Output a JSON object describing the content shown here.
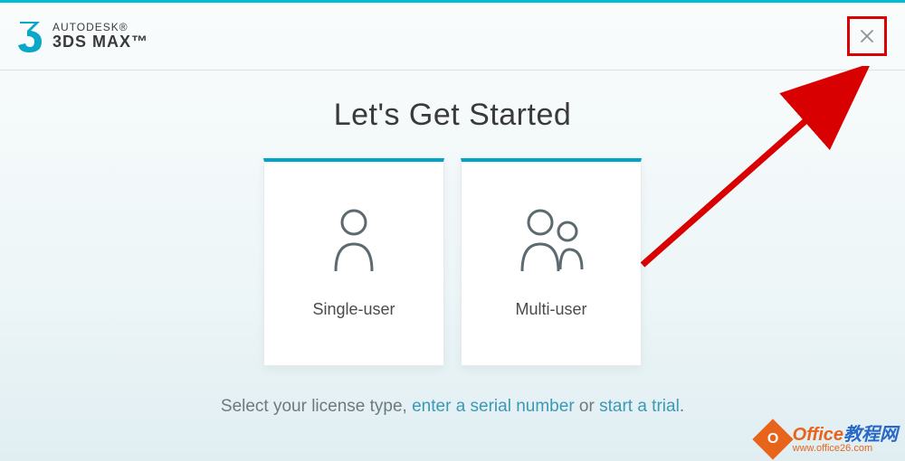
{
  "brand": {
    "top": "AUTODESK®",
    "bottom": "3DS MAX™"
  },
  "title": "Let's Get Started",
  "cards": {
    "single": {
      "label": "Single-user"
    },
    "multi": {
      "label": "Multi-user"
    }
  },
  "footer": {
    "prefix": "Select your license type, ",
    "link1": "enter a serial number",
    "middle": " or ",
    "link2": "start a trial",
    "suffix": "."
  },
  "watermark": {
    "icon_letter": "O",
    "brand_orange": "Office",
    "brand_blue": "教程网",
    "url": "www.office26.com"
  },
  "annotation": {
    "close_highlight_color": "#d80000",
    "arrow_color": "#d80000"
  }
}
